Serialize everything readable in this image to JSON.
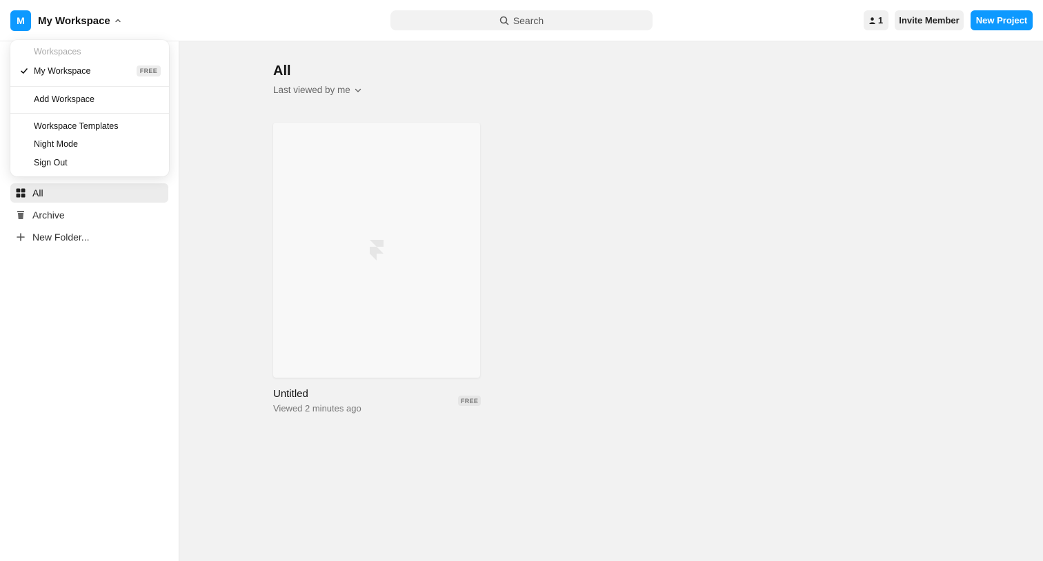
{
  "header": {
    "workspace_initial": "M",
    "workspace_name": "My Workspace",
    "search_placeholder": "Search",
    "member_count": "1",
    "invite_label": "Invite Member",
    "new_project_label": "New Project"
  },
  "dropdown": {
    "section_title": "Workspaces",
    "current_workspace": "My Workspace",
    "current_plan": "FREE",
    "add_workspace": "Add Workspace",
    "items": [
      "Workspace Templates",
      "Night Mode",
      "Sign Out"
    ]
  },
  "sidebar": {
    "items": [
      {
        "label": "All",
        "icon": "grid-icon",
        "active": true
      },
      {
        "label": "Archive",
        "icon": "trash-icon",
        "active": false
      },
      {
        "label": "New Folder...",
        "icon": "plus-icon",
        "active": false
      }
    ]
  },
  "main": {
    "title": "All",
    "sort_label": "Last viewed by me",
    "projects": [
      {
        "name": "Untitled",
        "meta": "Viewed 2 minutes ago",
        "plan": "FREE"
      }
    ]
  },
  "colors": {
    "accent": "#0d99ff",
    "background": "#f2f2f2"
  }
}
